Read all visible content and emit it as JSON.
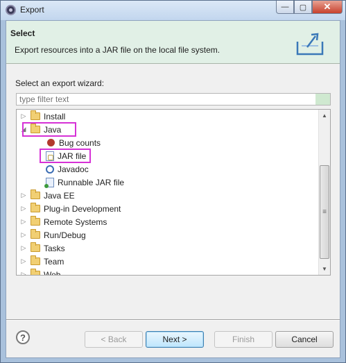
{
  "window": {
    "title": "Export",
    "minimize_glyph": "—",
    "maximize_glyph": "▢",
    "close_glyph": "✕"
  },
  "header": {
    "title": "Select",
    "description": "Export resources into a JAR file on the local file system."
  },
  "wizard": {
    "label": "Select an export wizard:",
    "filter_placeholder": "type filter text"
  },
  "tree": {
    "items": [
      {
        "label": "Install",
        "expanded": false,
        "icon": "folder-icon"
      },
      {
        "label": "Java",
        "expanded": true,
        "icon": "folder-icon"
      },
      {
        "label": "Bug counts",
        "icon": "bug-icon"
      },
      {
        "label": "JAR file",
        "icon": "jar-file-icon",
        "selected": true
      },
      {
        "label": "Javadoc",
        "icon": "javadoc-icon"
      },
      {
        "label": "Runnable JAR file",
        "icon": "runnable-jar-icon"
      },
      {
        "label": "Java EE",
        "expanded": false,
        "icon": "folder-icon"
      },
      {
        "label": "Plug-in Development",
        "expanded": false,
        "icon": "folder-icon"
      },
      {
        "label": "Remote Systems",
        "expanded": false,
        "icon": "folder-icon"
      },
      {
        "label": "Run/Debug",
        "expanded": false,
        "icon": "folder-icon"
      },
      {
        "label": "Tasks",
        "expanded": false,
        "icon": "folder-icon"
      },
      {
        "label": "Team",
        "expanded": false,
        "icon": "folder-icon"
      },
      {
        "label": "Web",
        "expanded": false,
        "icon": "folder-icon"
      }
    ],
    "collapsed_glyph": "▷",
    "expanded_glyph": "◢"
  },
  "scrollbar": {
    "up_glyph": "▲",
    "down_glyph": "▼",
    "grip_glyph": "≡"
  },
  "buttons": {
    "help": "?",
    "back": "< Back",
    "next": "Next >",
    "finish": "Finish",
    "cancel": "Cancel"
  },
  "colors": {
    "header_bg": "#e1f0e6",
    "highlight": "#d631d6",
    "window_frame": "#a9c1dc"
  }
}
